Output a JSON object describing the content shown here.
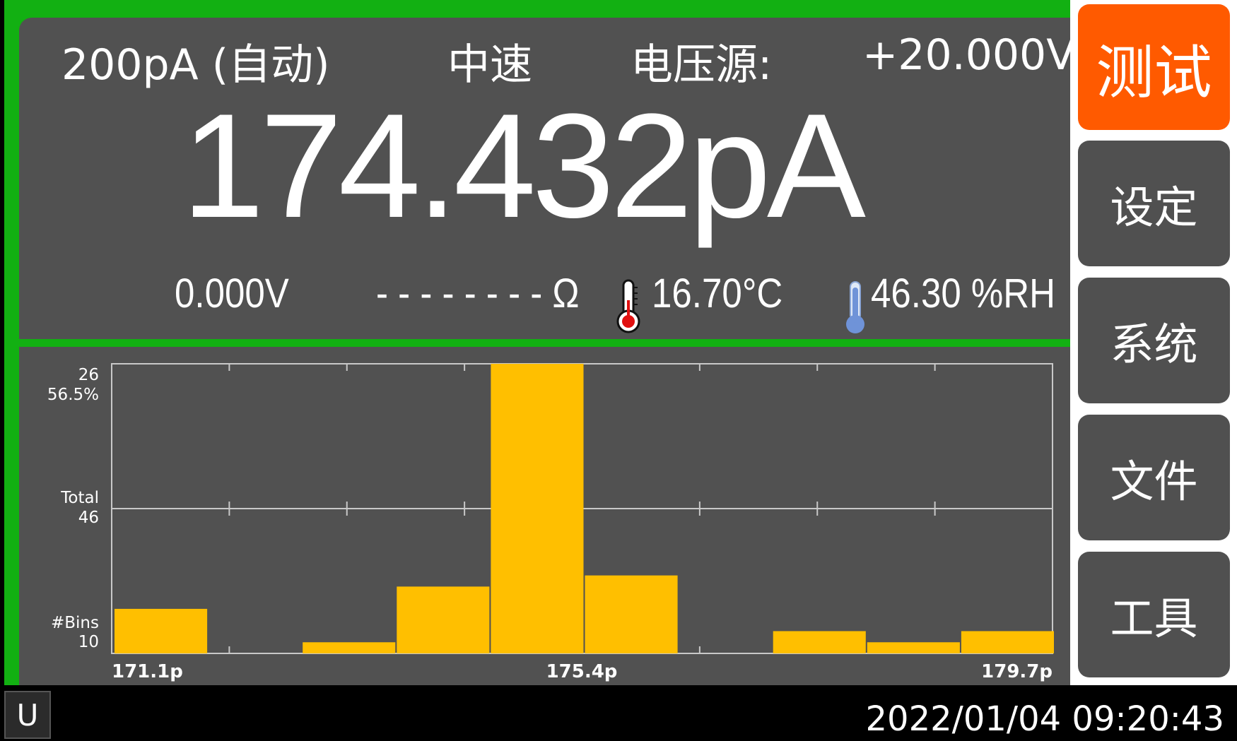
{
  "header": {
    "range": "200pA (自动)",
    "speed": "中速",
    "source_label": "电压源:",
    "source_value": "+20.000V"
  },
  "measurement": {
    "main_value": "174.432pA",
    "voltage": "0.000V",
    "resistance": "- - - - - - - - Ω",
    "temperature": "16.70",
    "temperature_unit": "°C",
    "humidity": "46.30 %RH"
  },
  "icons": {
    "temperature": "thermometer-icon",
    "humidity": "hygrometer-icon"
  },
  "chart_data": {
    "type": "bar",
    "title": "",
    "x_ticks": [
      "171.1p",
      "175.4p",
      "179.7p"
    ],
    "xlim": [
      171.1,
      179.7
    ],
    "bin_edges": [
      171.1,
      172.175,
      173.25,
      174.325,
      175.4,
      176.475,
      177.55,
      178.625,
      179.7
    ],
    "y_labels": {
      "top_count": "26",
      "top_percent": "56.5%",
      "total_label": "Total",
      "total_value": "46",
      "bins_label": "#Bins",
      "bins_value": "10"
    },
    "bins": 10,
    "total": 46,
    "ymax": 26,
    "values": [
      4,
      0,
      1,
      6,
      26,
      7,
      0,
      2,
      1,
      2
    ],
    "grid": true,
    "bar_color": "#ffbf00"
  },
  "menu": {
    "items": [
      {
        "label": "测试",
        "active": true
      },
      {
        "label": "设定",
        "active": false
      },
      {
        "label": "系统",
        "active": false
      },
      {
        "label": "文件",
        "active": false
      },
      {
        "label": "工具",
        "active": false
      }
    ]
  },
  "status_bar": {
    "mode": "U",
    "datetime": "2022/01/04 09:20:43"
  },
  "colors": {
    "frame_green": "#12b012",
    "panel_gray": "#515151",
    "active_orange": "#ff5a00",
    "bar_yellow": "#ffbf00"
  }
}
